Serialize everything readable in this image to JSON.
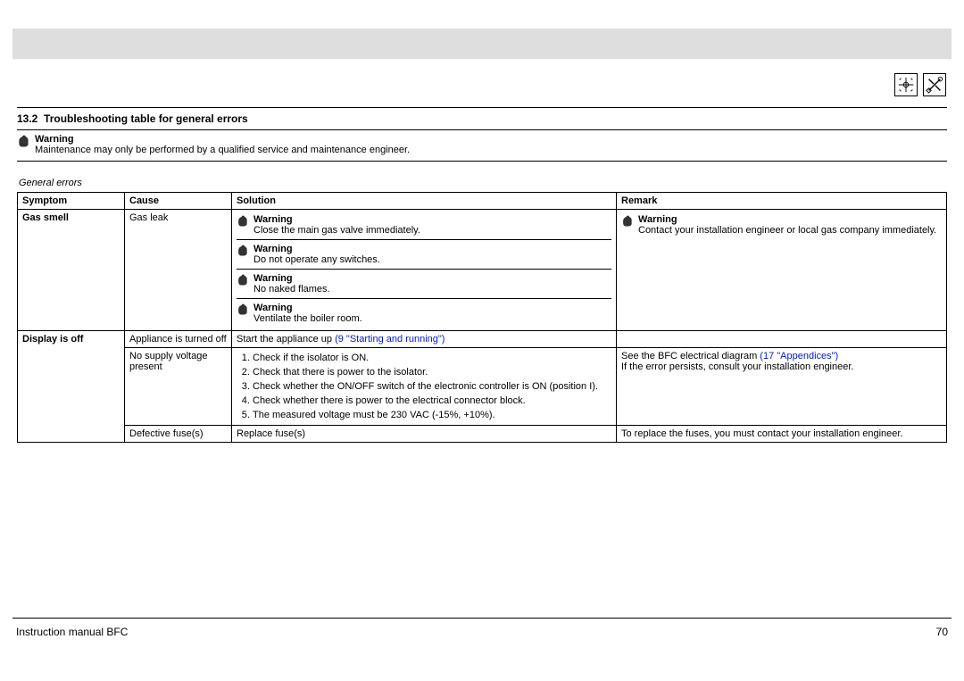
{
  "section": {
    "number": "13.2",
    "title": "Troubleshooting table for general errors"
  },
  "top_warning": {
    "label": "Warning",
    "text": "Maintenance may only be performed by a qualified service and maintenance engineer."
  },
  "table": {
    "caption": "General errors",
    "headers": {
      "symptom": "Symptom",
      "cause": "Cause",
      "solution": "Solution",
      "remark": "Remark"
    },
    "rows": {
      "gas_smell": {
        "symptom": "Gas smell",
        "cause": "Gas leak",
        "solution_warnings": [
          {
            "label": "Warning",
            "text": "Close the main gas valve immediately."
          },
          {
            "label": "Warning",
            "text": "Do not operate any switches."
          },
          {
            "label": "Warning",
            "text": "No naked flames."
          },
          {
            "label": "Warning",
            "text": "Ventilate the boiler room."
          }
        ],
        "remark_warning": {
          "label": "Warning",
          "text": "Contact your installation engineer or local gas company immediately."
        }
      },
      "display_off": {
        "symptom": "Display is off",
        "r1": {
          "cause": "Appliance is turned off",
          "solution_prefix": "Start the appliance up ",
          "solution_link": "(9 \"Starting and running\")"
        },
        "r2": {
          "cause": "No supply voltage present",
          "solution_steps": [
            "Check if the isolator is ON.",
            "Check that there is power to the isolator.",
            "Check whether the ON/OFF switch of the electronic controller is ON (position I).",
            "Check whether there is power to the electrical connector block.",
            "The measured voltage must be 230 VAC (-15%, +10%)."
          ],
          "remark_prefix": "See the BFC electrical diagram ",
          "remark_link": "(17 \"Appendices\")",
          "remark_line2": "If the error persists, consult your installation engineer."
        },
        "r3": {
          "cause": "Defective fuse(s)",
          "solution": "Replace fuse(s)",
          "remark": "To replace the fuses, you must contact your installation engineer."
        }
      }
    }
  },
  "footer": {
    "left": "Instruction manual BFC",
    "right": "70"
  }
}
